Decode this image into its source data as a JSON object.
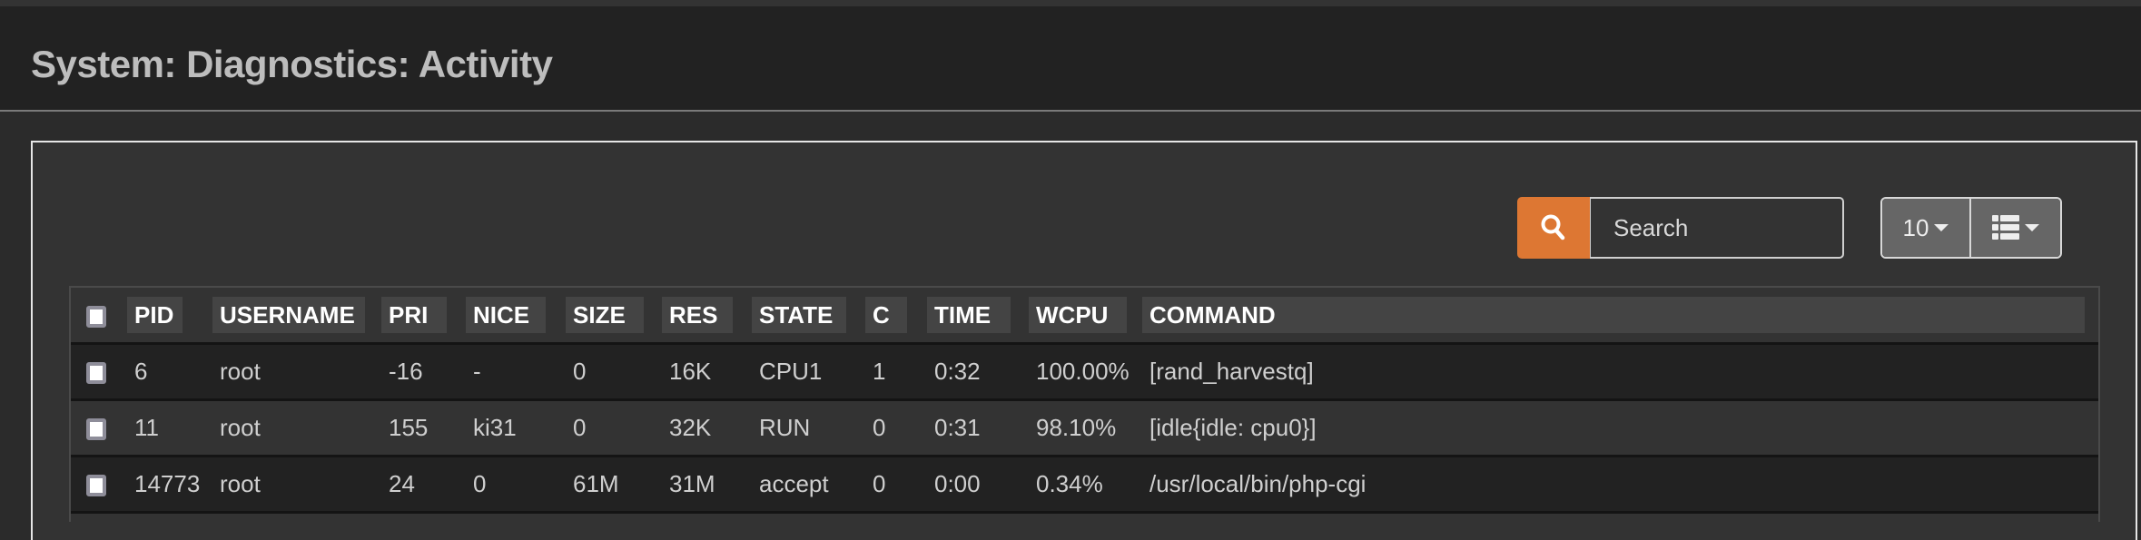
{
  "page": {
    "title": "System: Diagnostics: Activity"
  },
  "toolbar": {
    "search_placeholder": "Search",
    "search_icon": "search-icon",
    "rows_per_page": "10",
    "columns_icon": "list-columns-icon"
  },
  "colors": {
    "accent": "#dd7733",
    "header_bg": "#222222",
    "panel_bg": "#333333"
  },
  "table": {
    "columns": [
      "PID",
      "USERNAME",
      "PRI",
      "NICE",
      "SIZE",
      "RES",
      "STATE",
      "C",
      "TIME",
      "WCPU",
      "COMMAND"
    ],
    "rows": [
      {
        "pid": "6",
        "username": "root",
        "pri": "-16",
        "nice": "-",
        "size": "0",
        "res": "16K",
        "state": "CPU1",
        "c": "1",
        "time": "0:32",
        "wcpu": "100.00%",
        "command": "[rand_harvestq]"
      },
      {
        "pid": "11",
        "username": "root",
        "pri": "155",
        "nice": "ki31",
        "size": "0",
        "res": "32K",
        "state": "RUN",
        "c": "0",
        "time": "0:31",
        "wcpu": "98.10%",
        "command": "[idle{idle: cpu0}]"
      },
      {
        "pid": "14773",
        "username": "root",
        "pri": "24",
        "nice": "0",
        "size": "61M",
        "res": "31M",
        "state": "accept",
        "c": "0",
        "time": "0:00",
        "wcpu": "0.34%",
        "command": "/usr/local/bin/php-cgi"
      }
    ]
  }
}
